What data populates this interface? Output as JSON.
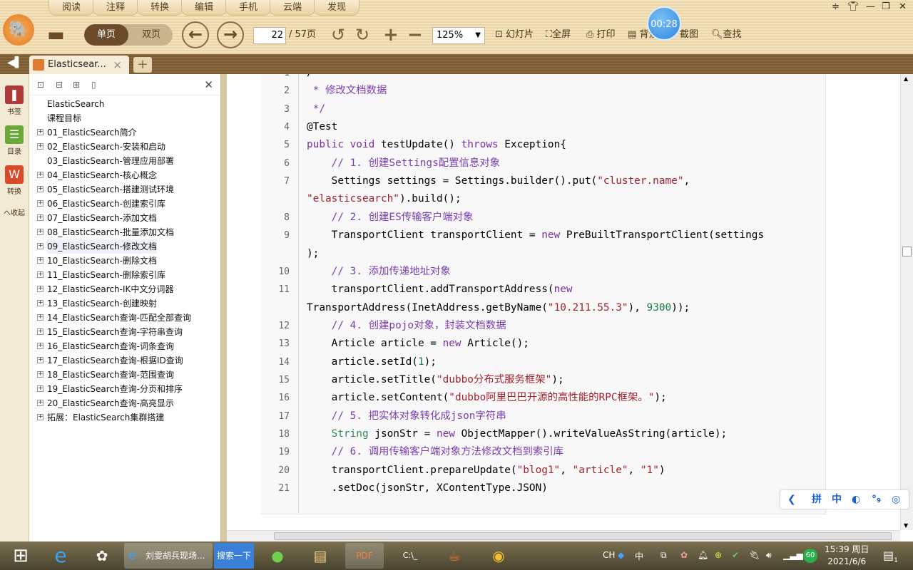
{
  "menu": {
    "tabs": [
      "阅读",
      "注释",
      "转换",
      "编辑",
      "手机",
      "云端",
      "发现"
    ]
  },
  "toolbar": {
    "single_page": "单页",
    "double_page": "双页",
    "current_page": "22",
    "total_pages": "/ 57页",
    "zoom": "125%",
    "slideshow": "幻灯片",
    "fullscreen": "全屏",
    "print": "打印",
    "background": "背景",
    "screenshot": "截图",
    "find": "查找",
    "timer": "00:28"
  },
  "tabs": {
    "doc_tab": "Elasticsear...",
    "close": "×",
    "new": "+"
  },
  "leftcol": {
    "bookmark": "书签",
    "toc": "目录",
    "convert": "转换",
    "collapse": "へ收起"
  },
  "toc": {
    "items": [
      {
        "label": "ElasticSearch",
        "expand": false
      },
      {
        "label": "课程目标",
        "expand": false
      },
      {
        "label": "01_ElasticSearch简介",
        "expand": true
      },
      {
        "label": "02_ElasticSearch-安装和启动",
        "expand": true
      },
      {
        "label": "03_ElasticSearch-管理应用部署",
        "expand": false
      },
      {
        "label": "04_ElasticSearch-核心概念",
        "expand": true
      },
      {
        "label": "05_ElasticSearch-搭建测试环境",
        "expand": true
      },
      {
        "label": "06_ElasticSearch-创建索引库",
        "expand": true
      },
      {
        "label": "07_ElasticSearch-添加文档",
        "expand": true
      },
      {
        "label": "08_ElasticSearch-批量添加文档",
        "expand": true
      },
      {
        "label": "09_ElasticSearch-修改文档",
        "expand": true
      },
      {
        "label": "10_ElasticSearch-删除文档",
        "expand": true
      },
      {
        "label": "11_ElasticSearch-删除索引库",
        "expand": true
      },
      {
        "label": "12_ElasticSearch-IK中文分词器",
        "expand": true
      },
      {
        "label": "13_ElasticSearch-创建映射",
        "expand": true
      },
      {
        "label": "14_ElasticSearch查询-匹配全部查询",
        "expand": true
      },
      {
        "label": "15_ElasticSearch查询-字符串查询",
        "expand": true
      },
      {
        "label": "16_ElasticSearch查询-词条查询",
        "expand": true
      },
      {
        "label": "17_ElasticSearch查询-根据ID查询",
        "expand": true
      },
      {
        "label": "18_ElasticSearch查询-范围查询",
        "expand": true
      },
      {
        "label": "19_ElasticSearch查询-分页和排序",
        "expand": true
      },
      {
        "label": "20_ElasticSearch查询-高亮显示",
        "expand": true
      },
      {
        "label": "拓展：ElasticSearch集群搭建",
        "expand": true
      }
    ],
    "selected": 10
  },
  "code": [
    {
      "n": "1",
      "t": [
        [
          "",
          "/"
        ]
      ]
    },
    {
      "n": "2",
      "t": [
        [
          "com",
          " * 修改文档数据"
        ]
      ]
    },
    {
      "n": "3",
      "t": [
        [
          "com",
          " */"
        ]
      ]
    },
    {
      "n": "4",
      "t": [
        [
          "",
          "@Test"
        ]
      ]
    },
    {
      "n": "5",
      "t": [
        [
          "kw",
          "public void "
        ],
        [
          "",
          "testUpdate() "
        ],
        [
          "kw",
          "throws "
        ],
        [
          "",
          "Exception{"
        ]
      ]
    },
    {
      "n": "6",
      "t": [
        [
          "com",
          "    // 1. 创建Settings配置信息对象"
        ]
      ]
    },
    {
      "n": "7",
      "t": [
        [
          "",
          "    Settings settings = Settings.builder().put("
        ],
        [
          "str",
          "\"cluster.name\""
        ],
        [
          "",
          ","
        ]
      ]
    },
    {
      "n": "",
      "t": [
        [
          "str",
          "\"elasticsearch\""
        ],
        [
          "",
          ").build();"
        ]
      ]
    },
    {
      "n": "8",
      "t": [
        [
          "com",
          "    // 2. 创建ES传输客户端对象"
        ]
      ]
    },
    {
      "n": "9",
      "t": [
        [
          "",
          "    TransportClient transportClient = "
        ],
        [
          "kw",
          "new "
        ],
        [
          "",
          "PreBuiltTransportClient(settings"
        ]
      ]
    },
    {
      "n": "",
      "t": [
        [
          "",
          ");"
        ]
      ]
    },
    {
      "n": "10",
      "t": [
        [
          "com",
          "    // 3. 添加传递地址对象"
        ]
      ]
    },
    {
      "n": "11",
      "t": [
        [
          "",
          "    transportClient.addTransportAddress("
        ],
        [
          "kw",
          "new"
        ]
      ]
    },
    {
      "n": "",
      "t": [
        [
          "",
          "TransportAddress(InetAddress.getByName("
        ],
        [
          "str",
          "\"10.211.55.3\""
        ],
        [
          "",
          "), "
        ],
        [
          "num",
          "9300"
        ],
        [
          "",
          "));"
        ]
      ]
    },
    {
      "n": "12",
      "t": [
        [
          "com",
          "    // 4. 创建pojo对象，封装文档数据"
        ]
      ]
    },
    {
      "n": "13",
      "t": [
        [
          "",
          "    Article article = "
        ],
        [
          "kw",
          "new "
        ],
        [
          "",
          "Article();"
        ]
      ]
    },
    {
      "n": "14",
      "t": [
        [
          "",
          "    article.setId("
        ],
        [
          "num",
          "1"
        ],
        [
          "",
          ");"
        ]
      ]
    },
    {
      "n": "15",
      "t": [
        [
          "",
          "    article.setTitle("
        ],
        [
          "str",
          "\"dubbo分布式服务框架\""
        ],
        [
          "",
          ");"
        ]
      ]
    },
    {
      "n": "16",
      "t": [
        [
          "",
          "    article.setContent("
        ],
        [
          "str",
          "\"dubbo阿里巴巴开源的高性能的RPC框架。\""
        ],
        [
          "",
          ");"
        ]
      ]
    },
    {
      "n": "17",
      "t": [
        [
          "com",
          "    // 5. 把实体对象转化成json字符串"
        ]
      ]
    },
    {
      "n": "18",
      "t": [
        [
          "ty",
          "    String "
        ],
        [
          "",
          "jsonStr = "
        ],
        [
          "kw",
          "new "
        ],
        [
          "",
          "ObjectMapper().writeValueAsString(article);"
        ]
      ]
    },
    {
      "n": "19",
      "t": [
        [
          "com",
          "    // 6. 调用传输客户端对象方法修改文档到索引库"
        ]
      ]
    },
    {
      "n": "20",
      "t": [
        [
          "",
          "    transportClient.prepareUpdate("
        ],
        [
          "str",
          "\"blog1\""
        ],
        [
          "",
          ", "
        ],
        [
          "str",
          "\"article\""
        ],
        [
          "",
          ", "
        ],
        [
          "str",
          "\"1\""
        ],
        [
          "",
          ")"
        ]
      ]
    },
    {
      "n": "21",
      "t": [
        [
          "",
          "    .setDoc(jsonStr, XContentType.JSON)"
        ]
      ]
    }
  ],
  "ime": {
    "items": [
      "拼",
      "中",
      "◐",
      "°₉",
      "◎"
    ]
  },
  "taskbar": {
    "ie_title": "刘雯胡兵现场...",
    "search": "搜索一下",
    "pdf": "PDF",
    "cmd": "C:\\_",
    "lang": "CH",
    "ime": "中",
    "battery": "60",
    "time": "15:39 周日",
    "date": "2021/6/6",
    "notif": "1"
  }
}
